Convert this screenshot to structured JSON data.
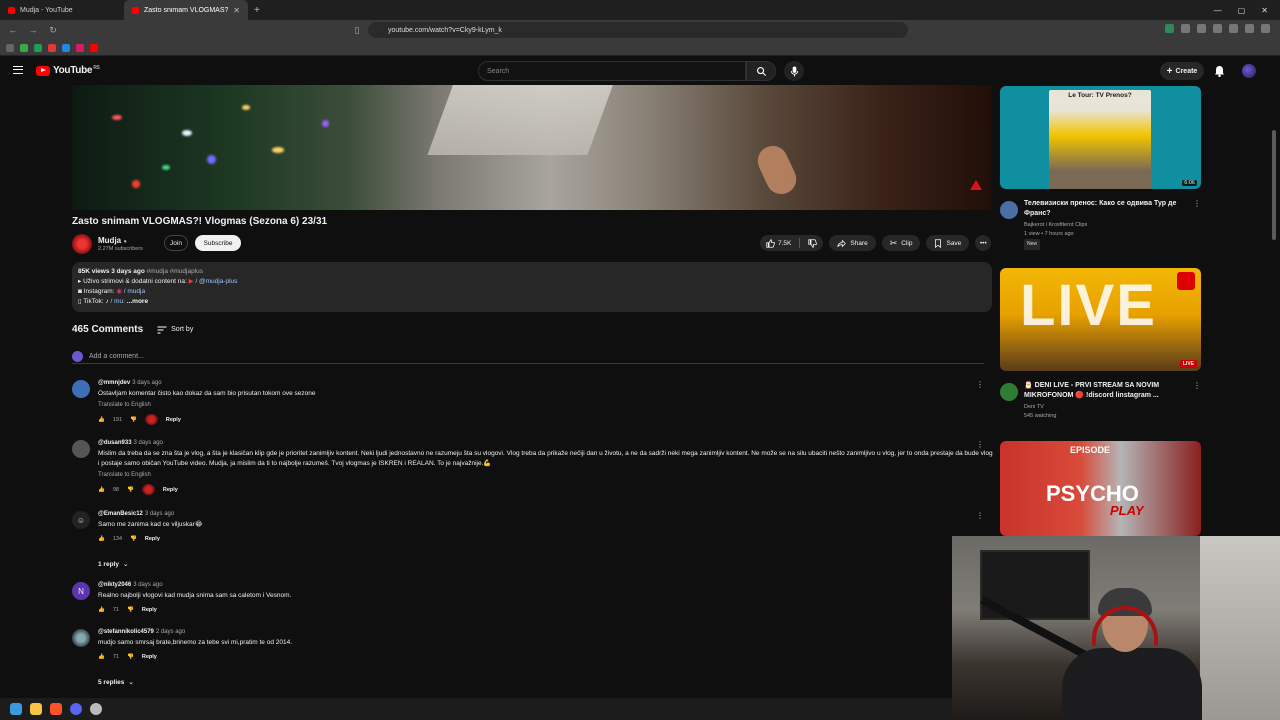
{
  "browser": {
    "tabs": [
      {
        "label": "Mudja - YouTube",
        "active": false
      },
      {
        "label": "Zasto snimam VLOGMAS?! Vlog",
        "active": true
      }
    ],
    "url": "youtube.com/watch?v=Cky9-kLym_k"
  },
  "header": {
    "logo_text": "YouTube",
    "logo_region": "RS",
    "search_placeholder": "Search",
    "create_label": "Create"
  },
  "video": {
    "title": "Zasto snimam VLOGMAS?! Vlogmas (Sezona 6) 23/31",
    "channel_name": "Mudja",
    "subscribers": "2.27M subscribers",
    "join_label": "Join",
    "subscribe_label": "Subscribe",
    "likes": "7.5K",
    "share_label": "Share",
    "clip_label": "Clip",
    "save_label": "Save"
  },
  "description": {
    "meta": "85K views  3 days ago",
    "tags": "#mudja #mudjaplus",
    "line1": "Uživo strimovi & dodatni content na:",
    "line1_link": "/ @mudja-plus",
    "line2": "Instagram:",
    "line2_link": "/ mudja",
    "line3": "TikTok:",
    "line3_link": "/ mu:",
    "more": "...more"
  },
  "comments": {
    "count_label": "465 Comments",
    "sort_label": "Sort by",
    "add_placeholder": "Add a comment...",
    "items": [
      {
        "user": "@mmnjdev",
        "time": "3 days ago",
        "text": "Ostavljam komentar čisto kao dokaz da sam bio prisutan tokom ove sezone",
        "translate": "Translate to English",
        "likes": "191",
        "reply_label": "Reply"
      },
      {
        "user": "@dusan933",
        "time": "3 days ago",
        "text": "Mislim da treba da se zna šta je vlog, a šta je klasičan klip gde je prioritet zanimljiv kontent. Neki ljudi jednostavno ne razumeju šta su vlogovi. Vlog treba da prikaže nečiji dan u životu, a ne da sadrži neki mega zanimljiv kontent. Ne može se na silu ubaciti nešto zanimljivo u vlog, jer to onda prestaje da bude vlog i postaje samo običan YouTube video. Mudja, ja mislim da ti to najbolje razumeš. Tvoj vlogmas je ISKREN i REALAN. To je najvažnije.💪",
        "translate": "Translate to English",
        "likes": "98",
        "reply_label": "Reply"
      },
      {
        "user": "@EmanBesic12",
        "time": "3 days ago",
        "text": "Samo me zanima kad ce viljuskar😂",
        "likes": "134",
        "reply_label": "Reply",
        "replies_label": "1 reply"
      },
      {
        "user": "@nikty2046",
        "time": "3 days ago",
        "text": "Realno najbolji vlogovi kad mudja snima sam sa caletom i Vesnom.",
        "likes": "71",
        "reply_label": "Reply",
        "avatar_letter": "N"
      },
      {
        "user": "@stefannikolic4579",
        "time": "2 days ago",
        "text": "mudjo samo smrsaj brate,brinemo za tebe svi mi,pratim te od 2014.",
        "likes": "71",
        "reply_label": "Reply",
        "replies_label": "5 replies"
      }
    ]
  },
  "sidebar": {
    "recs": [
      {
        "title": "Телевизиски пренос: Како се одвива Тур де Франс?",
        "channel": "Bajkerot i Krosfiterot Clips",
        "meta": "1 view • 7 hours ago",
        "badge": "New",
        "duration": "6:06",
        "thumb_text": "Le Tour: TV Prenos?"
      },
      {
        "title": "🎅 DENI LIVE - PRVI STREAM SA NOVIM MIKROFONOM 🔴 !discord linstagram ...",
        "channel": "Deni TV",
        "meta": "545 watching",
        "badge": "LIVE",
        "thumb_text": "LIVE"
      },
      {
        "title": "",
        "thumb_text": "PSYCHO",
        "thumb_sub": "PLAY",
        "thumb_top": "EPISODE"
      }
    ]
  },
  "colors": {
    "background": "#0f0f0f",
    "brand_red": "#ff0000",
    "pill_bg": "#272727"
  }
}
